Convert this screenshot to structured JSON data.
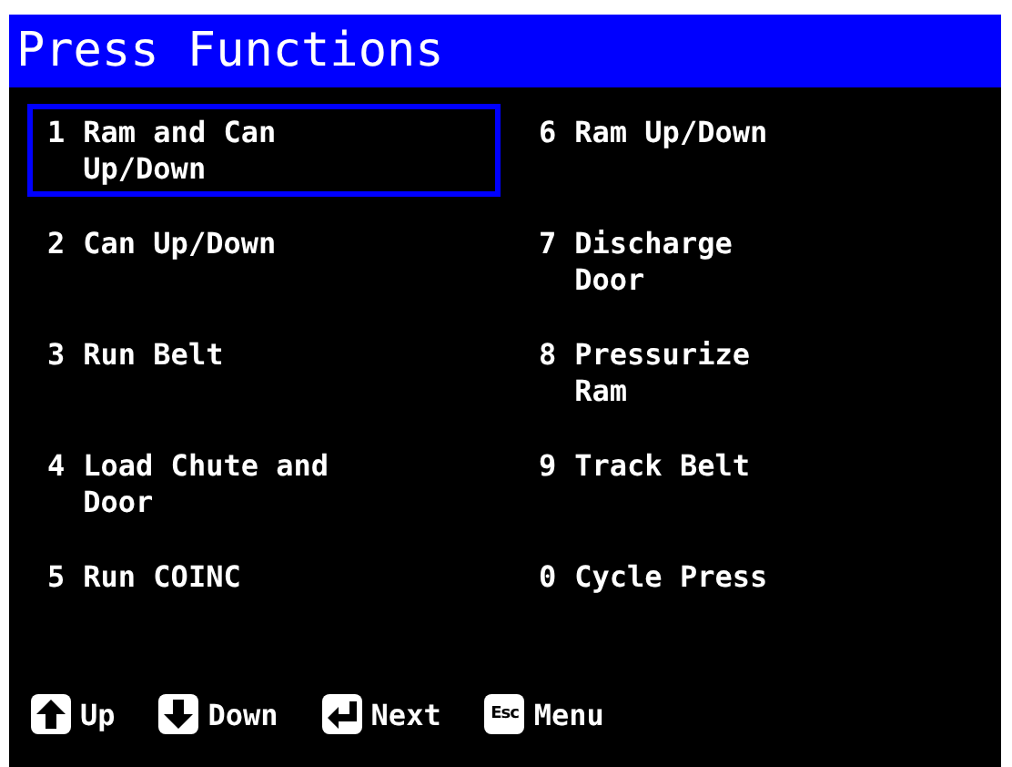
{
  "title": "Press Functions",
  "functions": [
    {
      "key": "1",
      "label": "Ram and Can Up/Down",
      "selected": true
    },
    {
      "key": "6",
      "label": "Ram Up/Down",
      "selected": false
    },
    {
      "key": "2",
      "label": "Can Up/Down",
      "selected": false
    },
    {
      "key": "7",
      "label": "Discharge Door",
      "selected": false
    },
    {
      "key": "3",
      "label": "Run Belt",
      "selected": false
    },
    {
      "key": "8",
      "label": "Pressurize Ram",
      "selected": false
    },
    {
      "key": "4",
      "label": "Load Chute and Door",
      "selected": false
    },
    {
      "key": "9",
      "label": "Track Belt",
      "selected": false
    },
    {
      "key": "5",
      "label": "Run COINC",
      "selected": false
    },
    {
      "key": "0",
      "label": "Cycle Press",
      "selected": false
    }
  ],
  "footer": [
    {
      "kind": "up",
      "label": "Up"
    },
    {
      "kind": "down",
      "label": "Down"
    },
    {
      "kind": "enter",
      "label": "Next"
    },
    {
      "kind": "esc",
      "cap": "Esc",
      "label": "Menu"
    }
  ]
}
